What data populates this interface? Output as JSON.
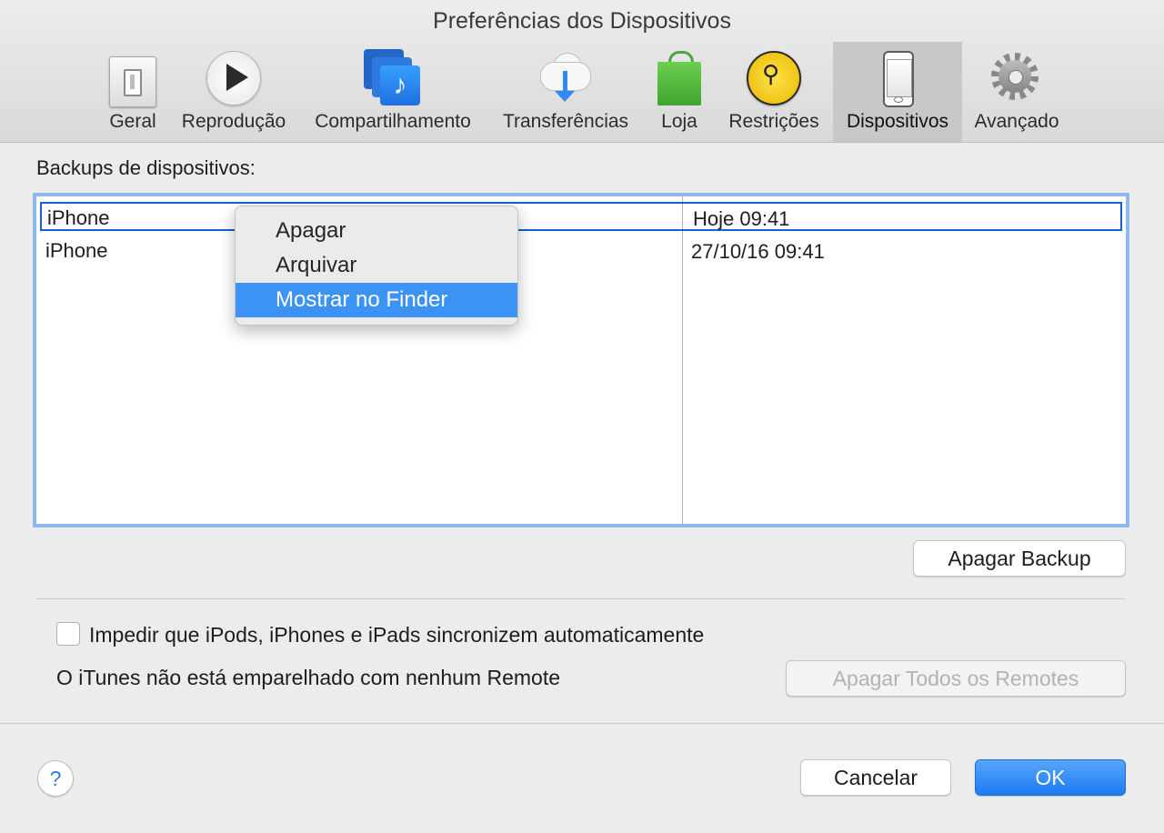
{
  "window": {
    "title": "Preferências dos Dispositivos"
  },
  "toolbar": {
    "tabs": [
      {
        "label": "Geral",
        "icon": "general-switch-icon"
      },
      {
        "label": "Reprodução",
        "icon": "play-icon"
      },
      {
        "label": "Compartilhamento",
        "icon": "music-share-icon"
      },
      {
        "label": "Transferências",
        "icon": "cloud-download-icon"
      },
      {
        "label": "Loja",
        "icon": "shopping-bag-icon"
      },
      {
        "label": "Restrições",
        "icon": "parental-restrictions-icon"
      },
      {
        "label": "Dispositivos",
        "icon": "iphone-icon",
        "selected": true
      },
      {
        "label": "Avançado",
        "icon": "gear-icon"
      }
    ]
  },
  "backups": {
    "label": "Backups de dispositivos:",
    "rows": [
      {
        "name": "iPhone",
        "date": "Hoje 09:41",
        "selected": true
      },
      {
        "name": "iPhone",
        "date": "27/10/16 09:41"
      }
    ]
  },
  "context_menu": {
    "items": [
      {
        "label": "Apagar"
      },
      {
        "label": "Arquivar"
      },
      {
        "label": "Mostrar no Finder",
        "highlighted": true
      }
    ]
  },
  "buttons": {
    "delete_backup": "Apagar Backup",
    "delete_all_remotes": "Apagar Todos os Remotes",
    "cancel": "Cancelar",
    "ok": "OK",
    "help": "?"
  },
  "options": {
    "prevent_sync_label": "Impedir que iPods, iPhones e iPads sincronizem automaticamente",
    "prevent_sync_checked": false,
    "remote_status": "O iTunes não está emparelhado com nenhum Remote"
  },
  "colors": {
    "accent": "#3b93f5",
    "selection_border": "#1a5ed6",
    "focus_ring": "#8fb8ee"
  }
}
